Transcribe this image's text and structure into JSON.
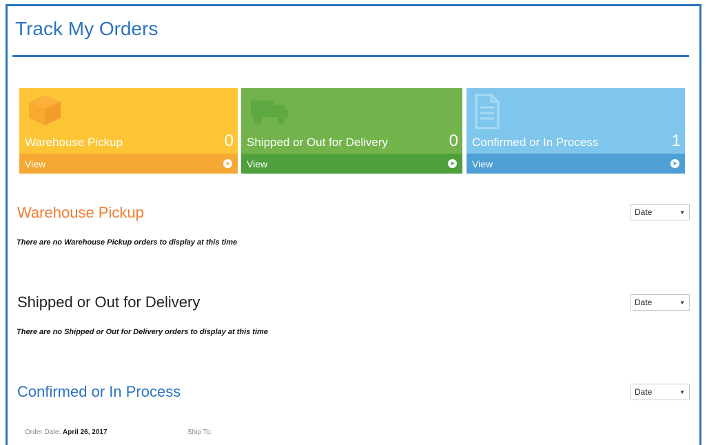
{
  "page": {
    "title": "Track My Orders"
  },
  "tiles": [
    {
      "label": "Warehouse Pickup",
      "count": "0",
      "footer": "View",
      "icon": "box-icon"
    },
    {
      "label": "Shipped or Out for Delivery",
      "count": "0",
      "footer": "View",
      "icon": "truck-icon"
    },
    {
      "label": "Confirmed or In Process",
      "count": "1",
      "footer": "View",
      "icon": "document-icon"
    }
  ],
  "sections": {
    "warehouse": {
      "heading": "Warehouse Pickup",
      "empty": "There are no Warehouse Pickup orders to display at this time",
      "sort": "Date",
      "color": "#f07d32"
    },
    "shipped": {
      "heading": "Shipped or Out for Delivery",
      "empty": "There are no Shipped or Out for Delivery orders to display at this time",
      "sort": "Date",
      "color": "#222222"
    },
    "confirmed": {
      "heading": "Confirmed or In Process",
      "sort": "Date",
      "color": "#2b74bf"
    }
  },
  "order": {
    "date_label": "Order Date:",
    "date_value": "April 26, 2017",
    "ship_to_label": "Ship To:"
  },
  "colors": {
    "accent": "#2b74bf",
    "orange": "#fdc435",
    "green": "#72b44b",
    "blue": "#7fc6ec"
  }
}
